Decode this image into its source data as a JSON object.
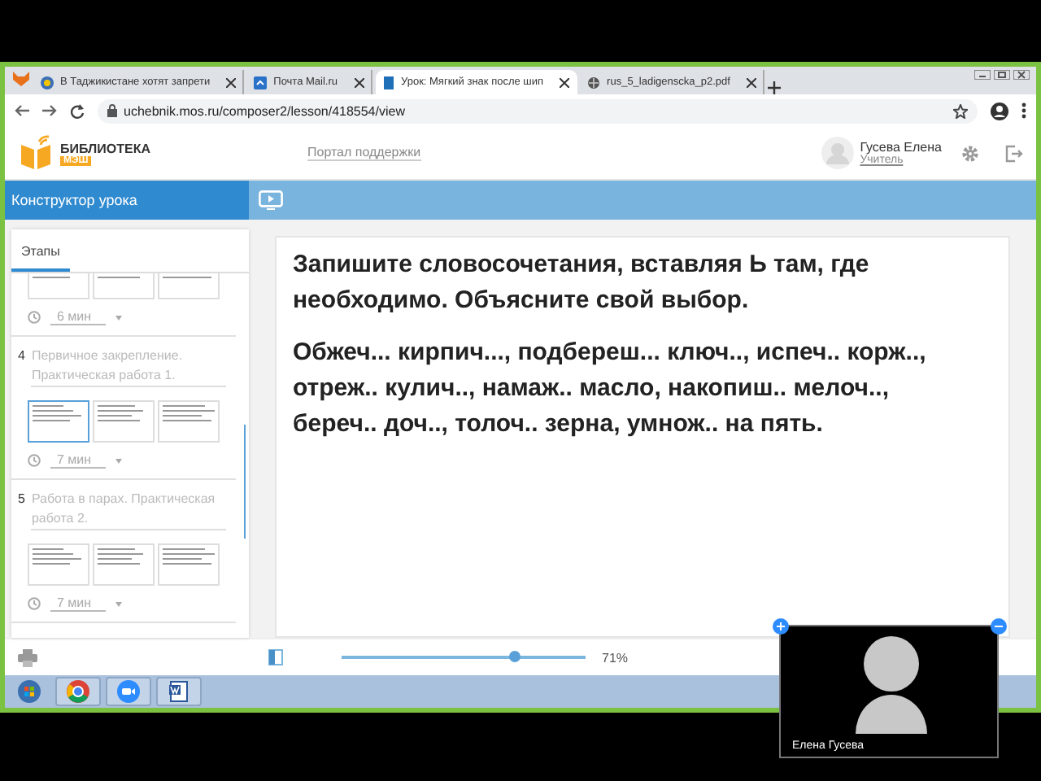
{
  "browser": {
    "tabs": [
      {
        "title": "В Таджикистане хотят запрети",
        "selected": false
      },
      {
        "title": "Почта Mail.ru",
        "selected": false
      },
      {
        "title": "Урок: Мягкий знак после шип",
        "selected": true
      },
      {
        "title": "rus_5_ladigenscka_p2.pdf",
        "selected": false
      }
    ],
    "address": "uchebnik.mos.ru/composer2/lesson/418554/view"
  },
  "header": {
    "logo_title": "БИБЛИОТЕКА",
    "logo_badge": "МЭШ",
    "support_link": "Портал поддержки",
    "user_name": "Гусева Елена",
    "user_role": "Учитель"
  },
  "toolbar": {
    "title": "Конструктор урока"
  },
  "sidebar": {
    "tabs": [
      {
        "label": "Этапы",
        "selected": true
      }
    ],
    "stages": [
      {
        "slides": [
          {
            "selected": false
          },
          {
            "selected": false
          },
          {
            "selected": false
          }
        ],
        "duration": "6 мин"
      },
      {
        "number": "4",
        "title": "Первичное закрепление. Практическая работа 1.",
        "slides": [
          {
            "selected": true
          },
          {
            "selected": false
          },
          {
            "selected": false
          }
        ],
        "duration": "7 мин"
      },
      {
        "number": "5",
        "title": "Работа в парах. Практическая работа 2.",
        "slides": [
          {
            "selected": false
          },
          {
            "selected": false
          },
          {
            "selected": false
          }
        ],
        "duration": "7 мин"
      }
    ]
  },
  "content": {
    "instruction": "Запишите словосочетания, вставляя Ь там, где необходимо. Объясните свой выбор.",
    "exercise": "Обжеч... кирпич..., подбереш... ключ.., испеч.. корж.., отреж.. кулич.., намаж.. масло, накопиш.. мелоч.., береч.. доч.., толоч.. зерна, умнож.. на пять."
  },
  "zoom": {
    "level": 0.71,
    "reading": "71%"
  },
  "video": {
    "name": "Елена Гусева"
  }
}
